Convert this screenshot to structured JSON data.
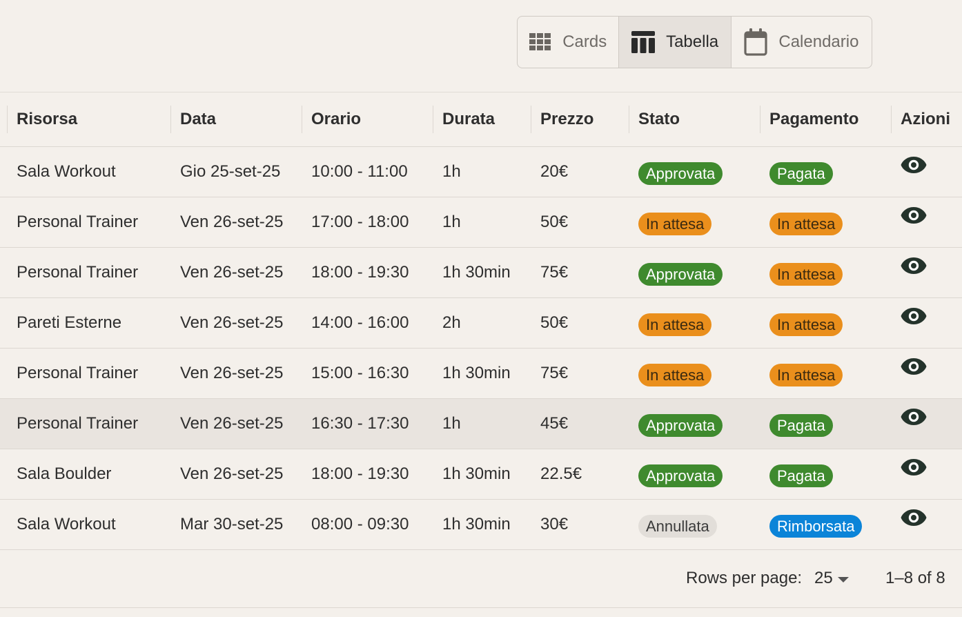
{
  "view_toggle": {
    "options": [
      {
        "label": "Cards",
        "icon": "grid-icon",
        "active": false
      },
      {
        "label": "Tabella",
        "icon": "table-columns-icon",
        "active": true
      },
      {
        "label": "Calendario",
        "icon": "calendar-icon",
        "active": false
      }
    ]
  },
  "table": {
    "columns": [
      "Risorsa",
      "Data",
      "Orario",
      "Durata",
      "Prezzo",
      "Stato",
      "Pagamento",
      "Azioni"
    ],
    "rows": [
      {
        "risorsa": "Sala Workout",
        "data": "Gio 25-set-25",
        "orario": "10:00 - 11:00",
        "durata": "1h",
        "prezzo": "20€",
        "stato": "Approvata",
        "stato_color": "green",
        "pagamento": "Pagata",
        "pagamento_color": "green",
        "action_icon": "eye-icon"
      },
      {
        "risorsa": "Personal Trainer",
        "data": "Ven 26-set-25",
        "orario": "17:00 - 18:00",
        "durata": "1h",
        "prezzo": "50€",
        "stato": "In attesa",
        "stato_color": "orange",
        "pagamento": "In attesa",
        "pagamento_color": "orange",
        "action_icon": "eye-icon"
      },
      {
        "risorsa": "Personal Trainer",
        "data": "Ven 26-set-25",
        "orario": "18:00 - 19:30",
        "durata": "1h 30min",
        "prezzo": "75€",
        "stato": "Approvata",
        "stato_color": "green",
        "pagamento": "In attesa",
        "pagamento_color": "orange",
        "action_icon": "eye-icon"
      },
      {
        "risorsa": "Pareti Esterne",
        "data": "Ven 26-set-25",
        "orario": "14:00 - 16:00",
        "durata": "2h",
        "prezzo": "50€",
        "stato": "In attesa",
        "stato_color": "orange",
        "pagamento": "In attesa",
        "pagamento_color": "orange",
        "action_icon": "eye-icon"
      },
      {
        "risorsa": "Personal Trainer",
        "data": "Ven 26-set-25",
        "orario": "15:00 - 16:30",
        "durata": "1h 30min",
        "prezzo": "75€",
        "stato": "In attesa",
        "stato_color": "orange",
        "pagamento": "In attesa",
        "pagamento_color": "orange",
        "action_icon": "eye-icon"
      },
      {
        "risorsa": "Personal Trainer",
        "data": "Ven 26-set-25",
        "orario": "16:30 - 17:30",
        "durata": "1h",
        "prezzo": "45€",
        "stato": "Approvata",
        "stato_color": "green",
        "pagamento": "Pagata",
        "pagamento_color": "green",
        "action_icon": "eye-icon",
        "hovered": true
      },
      {
        "risorsa": "Sala Boulder",
        "data": "Ven 26-set-25",
        "orario": "18:00 - 19:30",
        "durata": "1h 30min",
        "prezzo": "22.5€",
        "stato": "Approvata",
        "stato_color": "green",
        "pagamento": "Pagata",
        "pagamento_color": "green",
        "action_icon": "eye-icon"
      },
      {
        "risorsa": "Sala Workout",
        "data": "Mar 30-set-25",
        "orario": "08:00 - 09:30",
        "durata": "1h 30min",
        "prezzo": "30€",
        "stato": "Annullata",
        "stato_color": "grey",
        "pagamento": "Rimborsata",
        "pagamento_color": "blue",
        "action_icon": "eye-icon"
      }
    ]
  },
  "pagination": {
    "rows_per_page_label": "Rows per page:",
    "rows_per_page_value": "25",
    "range_text": "1–8 of 8"
  },
  "colors": {
    "background": "#f4f0eb",
    "chip_green": "#3f8a2e",
    "chip_orange": "#ea8f1c",
    "chip_grey": "#e2ded9",
    "chip_blue": "#0b84d8",
    "icon_dark": "#24332b"
  }
}
